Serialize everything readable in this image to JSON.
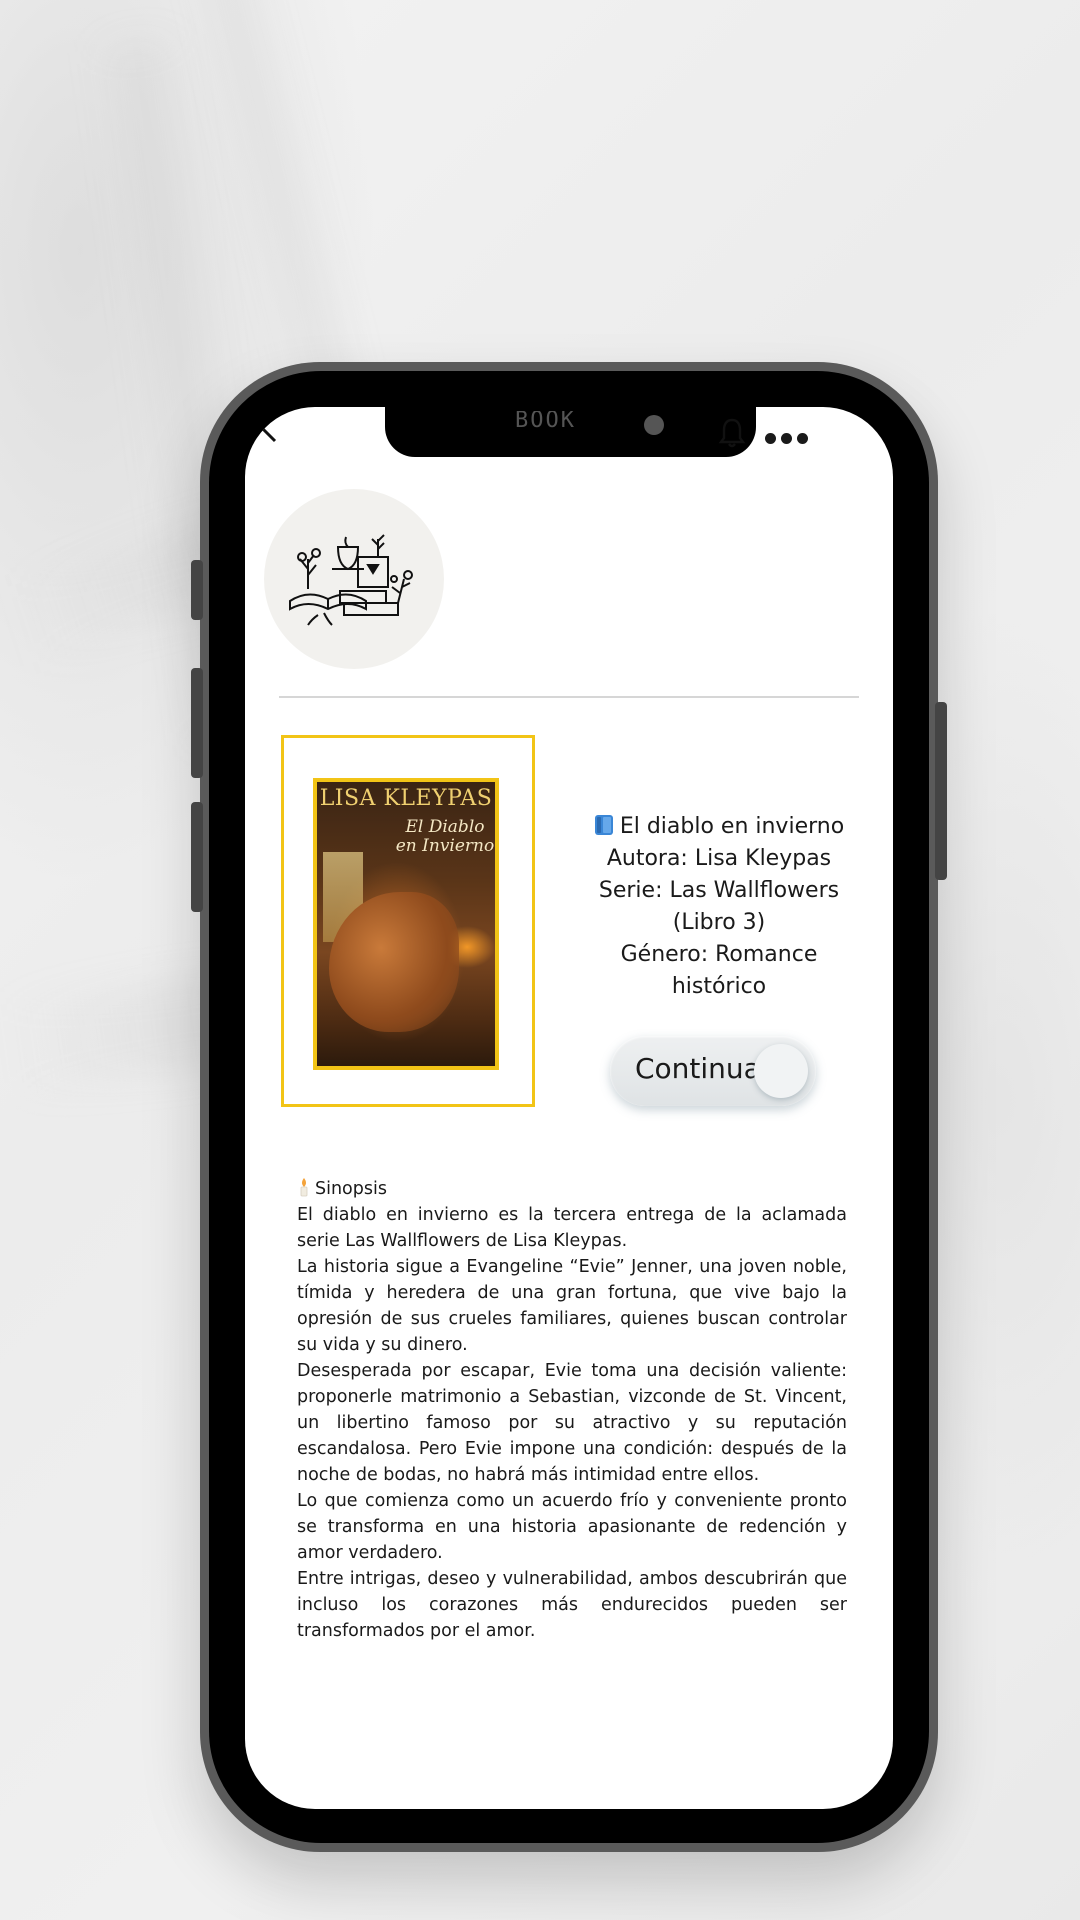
{
  "app": {
    "notch_text": "BOOK"
  },
  "book": {
    "icon": "blue-book-icon",
    "title_line": "El diablo en invierno",
    "author_line": "Autora: Lisa Kleypas",
    "series_line_1": "Serie: Las Wallflowers",
    "series_line_2": "(Libro 3)",
    "genre_line_1": "Género: Romance",
    "genre_line_2": "histórico",
    "cover_author": "LISA KLEYPAS",
    "cover_title": "El Diablo en Invierno",
    "accent_color": "#f2c416"
  },
  "actions": {
    "continue_label": "Continuar"
  },
  "synopsis": {
    "heading": "Sinopsis",
    "paragraphs": [
      "El diablo en invierno es la tercera entrega de la aclamada serie Las Wallflowers de Lisa Kleypas.",
      " La historia sigue a Evangeline “Evie” Jenner, una joven noble, tímida y heredera de una gran fortuna, que vive bajo la opresión de sus crueles familiares, quienes buscan controlar su vida y su dinero.",
      "Desesperada por escapar, Evie toma una decisión valiente: proponerle matrimonio a Sebastian, vizconde de St. Vincent, un libertino famoso por su atractivo y su reputación escandalosa. Pero Evie impone una condición: después de la noche de bodas, no habrá más intimidad entre ellos.",
      "Lo que comienza como un acuerdo frío y conveniente pronto se transforma en una historia apasionante de redención y amor verdadero.",
      " Entre intrigas, deseo y vulnerabilidad, ambos descubrirán que incluso los corazones más endurecidos pueden ser transformados por el amor."
    ]
  }
}
